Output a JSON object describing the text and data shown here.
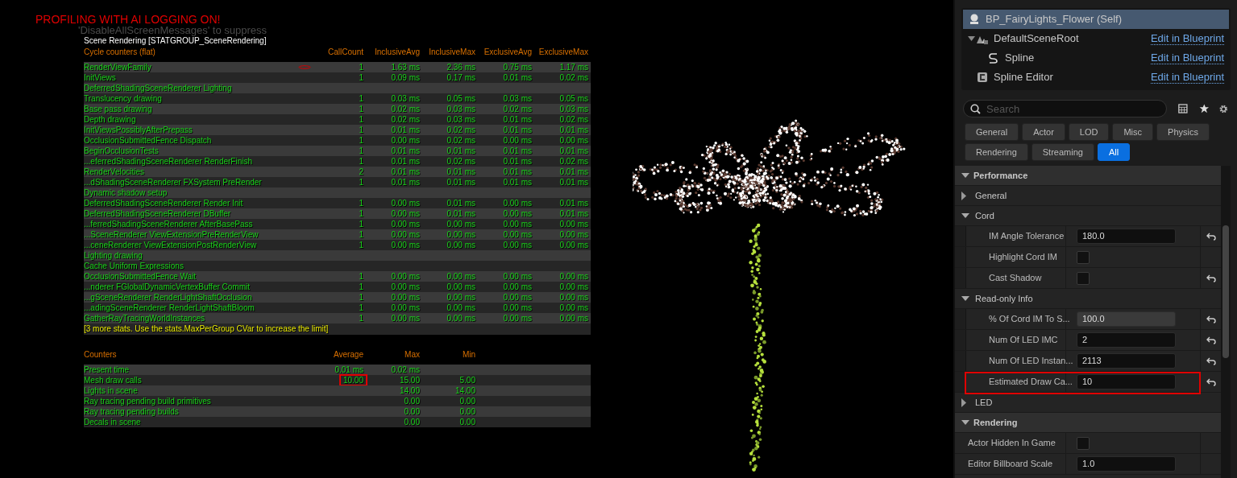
{
  "overlay": {
    "warning": "PROFILING WITH AI LOGGING ON!",
    "faint_message": "'DisableAllScreenMessages' to suppress",
    "group_title": "Scene Rendering [STATGROUP_SceneRendering]"
  },
  "cycle_counters": {
    "columns": [
      "Cycle counters (flat)",
      "CallCount",
      "InclusiveAvg",
      "InclusiveMax",
      "ExclusiveAvg",
      "ExclusiveMax"
    ],
    "rows": [
      {
        "name": "RenderViewFamily",
        "flagged": true,
        "values": [
          "1",
          "1.63 ms",
          "2.36 ms",
          "0.75 ms",
          "1.17 ms"
        ]
      },
      {
        "name": "InitViews",
        "flagged": false,
        "values": [
          "1",
          "0.09 ms",
          "0.17 ms",
          "0.01 ms",
          "0.02 ms"
        ]
      },
      {
        "name": "DeferredShadingSceneRenderer Lighting",
        "flagged": false
      },
      {
        "name": "Translucency drawing",
        "flagged": false,
        "values": [
          "1",
          "0.03 ms",
          "0.05 ms",
          "0.03 ms",
          "0.05 ms"
        ]
      },
      {
        "name": "Base pass drawing",
        "flagged": false,
        "values": [
          "1",
          "0.02 ms",
          "0.03 ms",
          "0.02 ms",
          "0.03 ms"
        ]
      },
      {
        "name": "Depth drawing",
        "flagged": false,
        "values": [
          "1",
          "0.02 ms",
          "0.03 ms",
          "0.01 ms",
          "0.02 ms"
        ]
      },
      {
        "name": "InitViewsPossiblyAfterPrepass",
        "flagged": false,
        "values": [
          "1",
          "0.01 ms",
          "0.02 ms",
          "0.01 ms",
          "0.01 ms"
        ]
      },
      {
        "name": "OcclusionSubmittedFence Dispatch",
        "flagged": false,
        "values": [
          "1",
          "0.00 ms",
          "0.02 ms",
          "0.00 ms",
          "0.00 ms"
        ]
      },
      {
        "name": "BeginOcclusionTests",
        "flagged": false,
        "values": [
          "1",
          "0.01 ms",
          "0.01 ms",
          "0.01 ms",
          "0.01 ms"
        ]
      },
      {
        "name": "...eferredShadingSceneRenderer RenderFinish",
        "flagged": false,
        "values": [
          "1",
          "0.01 ms",
          "0.02 ms",
          "0.01 ms",
          "0.02 ms"
        ]
      },
      {
        "name": "RenderVelocities",
        "flagged": false,
        "values": [
          "2",
          "0.01 ms",
          "0.01 ms",
          "0.01 ms",
          "0.01 ms"
        ]
      },
      {
        "name": "...dShadingSceneRenderer FXSystem PreRender",
        "flagged": false,
        "values": [
          "1",
          "0.01 ms",
          "0.01 ms",
          "0.01 ms",
          "0.01 ms"
        ]
      },
      {
        "name": "Dynamic shadow setup",
        "flagged": false
      },
      {
        "name": "DeferredShadingSceneRenderer Render Init",
        "flagged": false,
        "values": [
          "1",
          "0.00 ms",
          "0.01 ms",
          "0.00 ms",
          "0.01 ms"
        ]
      },
      {
        "name": "DeferredShadingSceneRenderer DBuffer",
        "flagged": false,
        "values": [
          "1",
          "0.00 ms",
          "0.01 ms",
          "0.00 ms",
          "0.01 ms"
        ]
      },
      {
        "name": "...ferredShadingSceneRenderer AfterBasePass",
        "flagged": false,
        "values": [
          "1",
          "0.00 ms",
          "0.00 ms",
          "0.00 ms",
          "0.00 ms"
        ]
      },
      {
        "name": "...SceneRenderer ViewExtensionPreRenderView",
        "flagged": false,
        "values": [
          "1",
          "0.00 ms",
          "0.00 ms",
          "0.00 ms",
          "0.00 ms"
        ]
      },
      {
        "name": "...ceneRenderer ViewExtensionPostRenderView",
        "flagged": false,
        "values": [
          "1",
          "0.00 ms",
          "0.00 ms",
          "0.00 ms",
          "0.00 ms"
        ]
      },
      {
        "name": "Lighting drawing",
        "flagged": false
      },
      {
        "name": "Cache Uniform Expressions",
        "flagged": false
      },
      {
        "name": "OcclusionSubmittedFence Wait",
        "flagged": false,
        "values": [
          "1",
          "0.00 ms",
          "0.00 ms",
          "0.00 ms",
          "0.00 ms"
        ]
      },
      {
        "name": "...nderer FGlobalDynamicVertexBuffer Commit",
        "flagged": false,
        "values": [
          "1",
          "0.00 ms",
          "0.00 ms",
          "0.00 ms",
          "0.00 ms"
        ]
      },
      {
        "name": "...gSceneRenderer RenderLightShaftOcclusion",
        "flagged": false,
        "values": [
          "1",
          "0.00 ms",
          "0.00 ms",
          "0.00 ms",
          "0.00 ms"
        ]
      },
      {
        "name": "...adingSceneRenderer RenderLightShaftBloom",
        "flagged": false,
        "values": [
          "1",
          "0.00 ms",
          "0.00 ms",
          "0.00 ms",
          "0.00 ms"
        ]
      },
      {
        "name": "GatherRayTracingWorldInstances",
        "flagged": false,
        "values": [
          "1",
          "0.00 ms",
          "0.00 ms",
          "0.00 ms",
          "0.00 ms"
        ]
      }
    ],
    "footer": "[3 more stats. Use the stats.MaxPerGroup CVar to increase the limit]"
  },
  "counters": {
    "columns": [
      "Counters",
      "Average",
      "Max",
      "Min"
    ],
    "rows": [
      {
        "name": "Present time",
        "average": "0.01 ms",
        "max": "0.02 ms",
        "highlighted": false
      },
      {
        "name": "Mesh draw calls",
        "average": "10.00",
        "max": "15.00",
        "min": "5.00",
        "highlighted": true
      },
      {
        "name": "Lights in scene",
        "max": "14.00",
        "min": "14.00",
        "highlighted": false
      },
      {
        "name": "Ray tracing pending build primitives",
        "max": "0.00",
        "min": "0.00",
        "highlighted": false
      },
      {
        "name": "Ray tracing pending builds",
        "max": "0.00",
        "min": "0.00",
        "highlighted": false
      },
      {
        "name": "Decals in scene",
        "max": "0.00",
        "min": "0.00",
        "highlighted": false
      }
    ]
  },
  "components": [
    {
      "label": "BP_FairyLights_Flower (Self)",
      "kind": "actor",
      "selected": true
    },
    {
      "label": "DefaultSceneRoot",
      "kind": "scene_root",
      "selected": false,
      "link": "Edit in Blueprint",
      "expanded": true,
      "children": [
        {
          "label": "Spline",
          "kind": "spline",
          "selected": false,
          "link": "Edit in Blueprint"
        }
      ]
    },
    {
      "label": "Spline Editor",
      "kind": "component",
      "selected": false,
      "link": "Edit in Blueprint"
    }
  ],
  "search": {
    "placeholder": "Search"
  },
  "filters": [
    {
      "label": "General",
      "selected": false
    },
    {
      "label": "Actor",
      "selected": false
    },
    {
      "label": "LOD",
      "selected": false
    },
    {
      "label": "Misc",
      "selected": false
    },
    {
      "label": "Physics",
      "selected": false
    },
    {
      "label": "Rendering",
      "selected": false
    },
    {
      "label": "Streaming",
      "selected": false
    },
    {
      "label": "All",
      "selected": true
    }
  ],
  "details": [
    {
      "kind": "category",
      "label": "Performance",
      "expanded": true
    },
    {
      "kind": "group",
      "label": "General",
      "expanded": false
    },
    {
      "kind": "group",
      "label": "Cord",
      "expanded": true
    },
    {
      "kind": "field",
      "label": "IM Angle Tolerance",
      "value": "180.0",
      "resettable": true,
      "highlighted": false
    },
    {
      "kind": "checkbox",
      "label": "Highlight Cord IM",
      "checked": false,
      "resettable": false,
      "highlighted": false
    },
    {
      "kind": "checkbox",
      "label": "Cast Shadow",
      "checked": false,
      "resettable": true,
      "highlighted": false
    },
    {
      "kind": "group",
      "label": "Read-only Info",
      "expanded": true
    },
    {
      "kind": "readonly",
      "label": "% Of Cord IM To S...",
      "value": "100.0",
      "resettable": true,
      "highlighted": false
    },
    {
      "kind": "field",
      "label": "Num Of LED IMC",
      "value": "2",
      "resettable": true,
      "highlighted": false
    },
    {
      "kind": "field",
      "label": "Num Of LED Instan...",
      "value": "2113",
      "resettable": true,
      "highlighted": false
    },
    {
      "kind": "field",
      "label": "Estimated Draw Ca...",
      "value": "10",
      "resettable": true,
      "highlighted": true
    },
    {
      "kind": "group",
      "label": "LED",
      "expanded": false
    },
    {
      "kind": "category",
      "label": "Rendering",
      "expanded": true
    },
    {
      "kind": "top_checkbox",
      "label": "Actor Hidden In Game",
      "checked": false,
      "resettable": false,
      "highlighted": false
    },
    {
      "kind": "top_field",
      "label": "Editor Billboard Scale",
      "value": "1.0",
      "resettable": false,
      "highlighted": false
    }
  ]
}
